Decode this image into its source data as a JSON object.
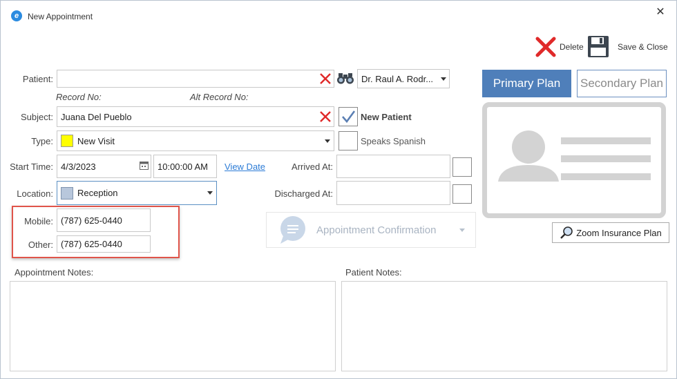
{
  "window": {
    "title": "New Appointment",
    "close_glyph": "✕"
  },
  "toolbar": {
    "delete_label": "Delete",
    "save_close_label": "Save & Close"
  },
  "form": {
    "patient_label": "Patient:",
    "patient_value": "",
    "record_no_label": "Record No:",
    "alt_record_no_label": "Alt Record No:",
    "subject_label": "Subject:",
    "subject_value": "Juana Del Pueblo",
    "type_label": "Type:",
    "type_value": "New Visit",
    "type_color": "#ffff00",
    "start_time_label": "Start Time:",
    "start_date_value": "4/3/2023",
    "start_time_value": "10:00:00 AM",
    "view_date_link": "View Date",
    "arrived_label": "Arrived At:",
    "location_label": "Location:",
    "location_value": "Reception",
    "location_color": "#b8c7dc",
    "discharged_label": "Discharged At:",
    "mobile_label": "Mobile:",
    "mobile_value": "(787) 625-0440",
    "other_label": "Other:",
    "other_value": "(787) 625-0440",
    "doctor_value": "Dr. Raul A. Rodr...",
    "new_patient_label": "New Patient",
    "new_patient_checked": true,
    "speaks_spanish_label": "Speaks Spanish",
    "speaks_spanish_checked": false
  },
  "plans": {
    "primary_label": "Primary Plan",
    "secondary_label": "Secondary Plan",
    "zoom_label": "Zoom Insurance Plan"
  },
  "confirmation": {
    "label": "Appointment Confirmation"
  },
  "notes": {
    "appointment_notes_label": "Appointment Notes:",
    "patient_notes_label": "Patient Notes:"
  },
  "colors": {
    "accent": "#4f7fba",
    "delete_red": "#e02a2a",
    "highlight_red": "#e0544a",
    "link_blue": "#2b7bd6"
  }
}
